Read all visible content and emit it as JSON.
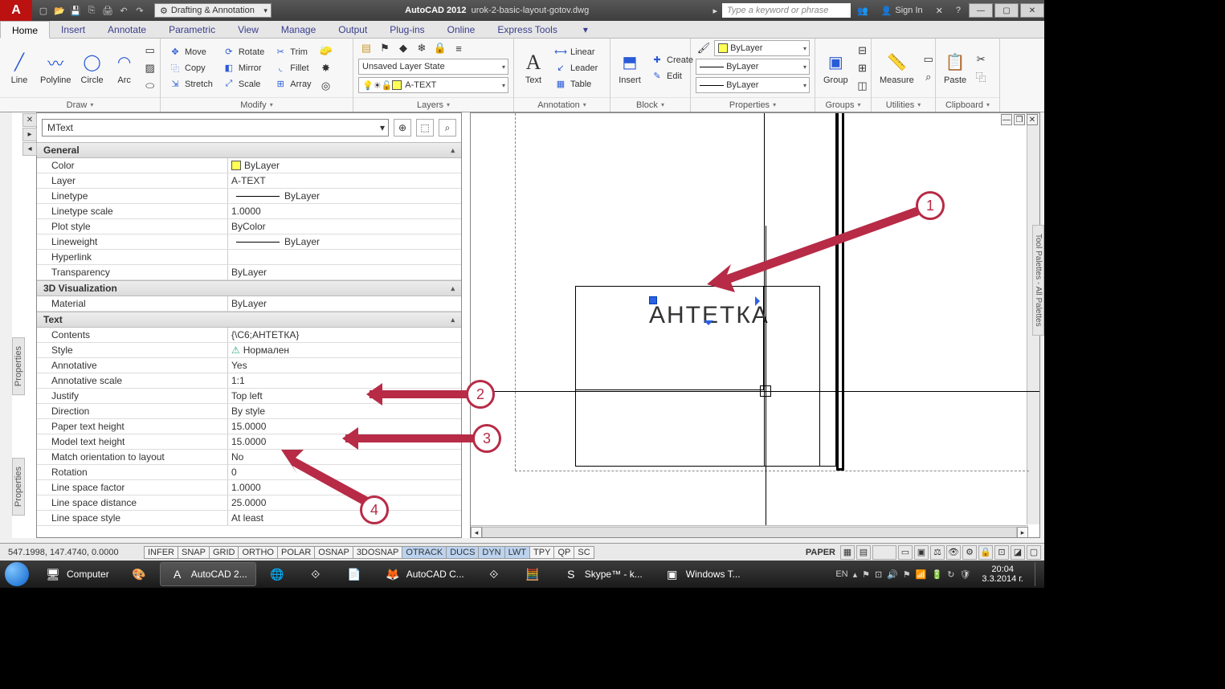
{
  "title": {
    "app": "AutoCAD 2012",
    "file": "urok-2-basic-layout-gotov.dwg"
  },
  "workspace": "Drafting & Annotation",
  "searchPlaceholder": "Type a keyword or phrase",
  "signIn": "Sign In",
  "ribbonTabs": [
    "Home",
    "Insert",
    "Annotate",
    "Parametric",
    "View",
    "Manage",
    "Output",
    "Plug-ins",
    "Online",
    "Express Tools"
  ],
  "activeTab": "Home",
  "panels": {
    "draw": {
      "label": "Draw",
      "tools": [
        "Line",
        "Polyline",
        "Circle",
        "Arc"
      ]
    },
    "modify": {
      "label": "Modify",
      "row1": [
        "Move",
        "Rotate",
        "Trim"
      ],
      "row2": [
        "Copy",
        "Mirror",
        "Fillet"
      ],
      "row3": [
        "Stretch",
        "Scale",
        "Array"
      ]
    },
    "layers": {
      "label": "Layers",
      "state": "Unsaved Layer State",
      "current": "A-TEXT"
    },
    "annotation": {
      "label": "Annotation",
      "text": "Text",
      "items": [
        "Linear",
        "Leader",
        "Table"
      ]
    },
    "block": {
      "label": "Block",
      "insert": "Insert",
      "items": [
        "Create",
        "Edit"
      ]
    },
    "properties": {
      "label": "Properties",
      "color": "ByLayer",
      "line": "ByLayer",
      "lw": "ByLayer"
    },
    "groups": {
      "label": "Groups",
      "group": "Group"
    },
    "utilities": {
      "label": "Utilities",
      "measure": "Measure"
    },
    "clipboard": {
      "label": "Clipboard",
      "paste": "Paste"
    }
  },
  "palette": {
    "objectType": "MText",
    "sections": {
      "general": {
        "title": "General",
        "rows": [
          {
            "k": "Color",
            "v": "ByLayer",
            "sw": "#ffff55"
          },
          {
            "k": "Layer",
            "v": "A-TEXT"
          },
          {
            "k": "Linetype",
            "v": "ByLayer",
            "line": true
          },
          {
            "k": "Linetype scale",
            "v": "1.0000"
          },
          {
            "k": "Plot style",
            "v": "ByColor"
          },
          {
            "k": "Lineweight",
            "v": "ByLayer",
            "line": true
          },
          {
            "k": "Hyperlink",
            "v": ""
          },
          {
            "k": "Transparency",
            "v": "ByLayer"
          }
        ]
      },
      "viz": {
        "title": "3D Visualization",
        "rows": [
          {
            "k": "Material",
            "v": "ByLayer"
          }
        ]
      },
      "text": {
        "title": "Text",
        "rows": [
          {
            "k": "Contents",
            "v": "{\\C6;АНТЕТКА}"
          },
          {
            "k": "Style",
            "v": "Нормален",
            "ico": "⚠"
          },
          {
            "k": "Annotative",
            "v": "Yes"
          },
          {
            "k": "Annotative scale",
            "v": "1:1"
          },
          {
            "k": "Justify",
            "v": "Top left"
          },
          {
            "k": "Direction",
            "v": "By style"
          },
          {
            "k": "Paper text height",
            "v": "15.0000"
          },
          {
            "k": "Model text height",
            "v": "15.0000"
          },
          {
            "k": "Match orientation to layout",
            "v": "No"
          },
          {
            "k": "Rotation",
            "v": "0"
          },
          {
            "k": "Line space factor",
            "v": "1.0000"
          },
          {
            "k": "Line space distance",
            "v": "25.0000"
          },
          {
            "k": "Line space style",
            "v": "At least"
          }
        ]
      }
    }
  },
  "propertiesLabel": "Properties",
  "toolPalettes": "Tool Palettes - All Palettes",
  "canvas": {
    "mtext": "АНТЕТКА"
  },
  "annotations": [
    "1",
    "2",
    "3",
    "4"
  ],
  "status": {
    "coords": "547.1998, 147.4740, 0.0000",
    "toggles": [
      "INFER",
      "SNAP",
      "GRID",
      "ORTHO",
      "POLAR",
      "OSNAP",
      "3DOSNAP",
      "OTRACK",
      "DUCS",
      "DYN",
      "LWT",
      "TPY",
      "QP",
      "SC"
    ],
    "togglesOn": [
      "OTRACK",
      "DUCS",
      "DYN",
      "LWT"
    ],
    "space": "PAPER"
  },
  "taskbar": {
    "items": [
      {
        "label": "Computer",
        "icon": "🖥"
      },
      {
        "label": "",
        "icon": "🎨"
      },
      {
        "label": "AutoCAD 2...",
        "icon": "A",
        "active": true
      },
      {
        "label": "",
        "icon": "🌐"
      },
      {
        "label": "",
        "icon": "⟐"
      },
      {
        "label": "",
        "icon": "📄"
      },
      {
        "label": "AutoCAD С...",
        "icon": "🦊"
      },
      {
        "label": "",
        "icon": "⟐"
      },
      {
        "label": "",
        "icon": "🧮"
      },
      {
        "label": "Skype™ - k...",
        "icon": "S"
      },
      {
        "label": "Windows T...",
        "icon": "▣"
      }
    ],
    "lang": "EN",
    "time": "20:04",
    "date": "3.3.2014 г."
  }
}
